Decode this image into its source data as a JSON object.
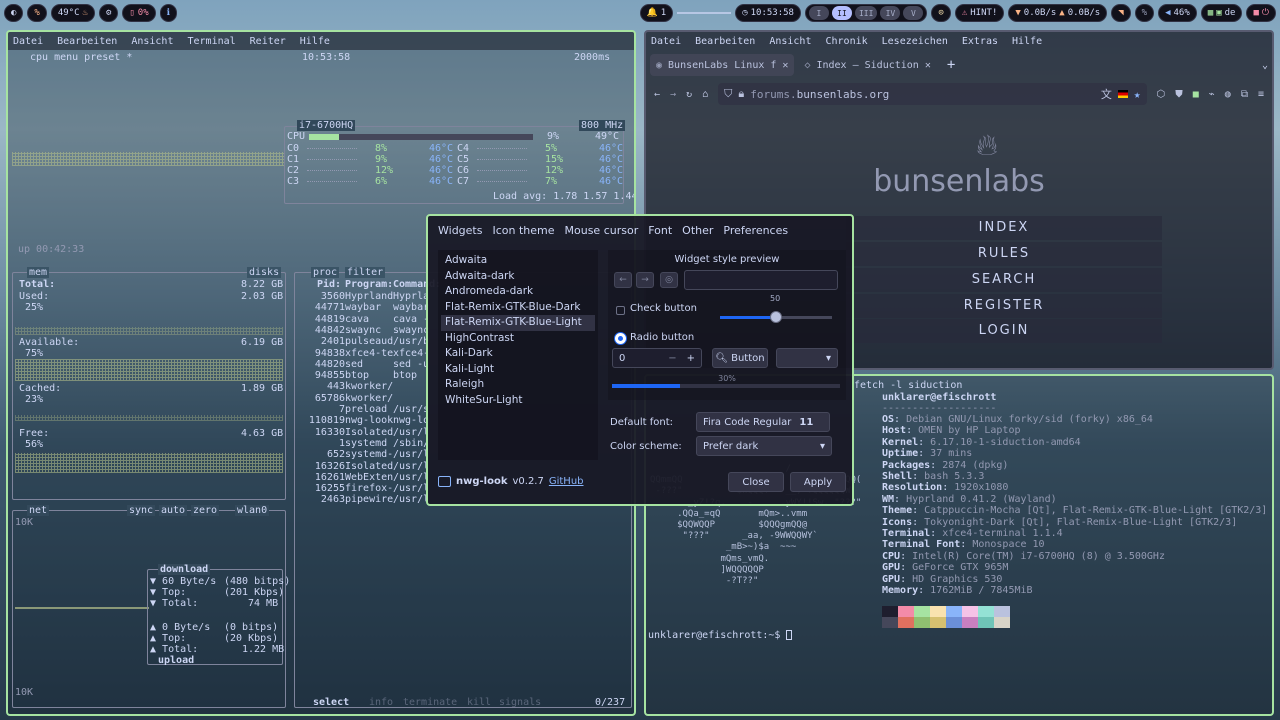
{
  "topbar": {
    "temp": "49°C",
    "battery": "0%",
    "notifications": "1",
    "clock": "10:53:58",
    "workspaces": [
      "I",
      "II",
      "III",
      "IV",
      "V"
    ],
    "active_workspace": "II",
    "hint": "HINT!",
    "net_down": "0.0B/s",
    "net_up": "0.0B/s",
    "volume": "46%",
    "keyboard": "de"
  },
  "btop": {
    "menu": [
      "Datei",
      "Bearbeiten",
      "Ansicht",
      "Terminal",
      "Reiter",
      "Hilfe"
    ],
    "header_left": "cpu   menu  preset *",
    "header_clock": "10:53:58",
    "header_interval": "2000ms",
    "cpu_model": "i7-6700HQ",
    "cpu_freq": "800 MHz",
    "cpu_total_label": "CPU",
    "cpu_total_pct": "9%",
    "cpu_total_temp": "49°C",
    "cpu_total_fraction": 0.09,
    "cores": [
      {
        "name": "C0",
        "pct": "8%",
        "temp": "46°C"
      },
      {
        "name": "C1",
        "pct": "9%",
        "temp": "46°C"
      },
      {
        "name": "C2",
        "pct": "12%",
        "temp": "46°C"
      },
      {
        "name": "C3",
        "pct": "6%",
        "temp": "46°C"
      },
      {
        "name": "C4",
        "pct": "5%",
        "temp": "46°C"
      },
      {
        "name": "C5",
        "pct": "15%",
        "temp": "46°C"
      },
      {
        "name": "C6",
        "pct": "12%",
        "temp": "46°C"
      },
      {
        "name": "C7",
        "pct": "7%",
        "temp": "46°C"
      }
    ],
    "load_avg": "Load avg: 1.78 1.57 1.44",
    "uptime": "up 00:42:33",
    "mem_title": "mem",
    "disks_title": "disks",
    "mem": {
      "total_label": "Total:",
      "total": "8.22 GB",
      "used_label": "Used:",
      "used": "2.03 GB",
      "used_pct": "25%",
      "avail_label": "Available:",
      "avail": "6.19 GB",
      "avail_pct": "75%",
      "cached_label": "Cached:",
      "cached": "1.89 GB",
      "cached_pct": "23%",
      "free_label": "Free:",
      "free": "4.63 GB",
      "free_pct": "56%"
    },
    "proc_title": "proc",
    "proc_filter": "filter",
    "proc_headers": {
      "pid": "Pid:",
      "program": "Program:",
      "command": "Command:"
    },
    "procs": [
      {
        "pid": "3560",
        "prog": "Hyprland",
        "cmd": "Hyprla"
      },
      {
        "pid": "44771",
        "prog": "waybar",
        "cmd": "waybar"
      },
      {
        "pid": "44819",
        "prog": "cava",
        "cmd": "cava -"
      },
      {
        "pid": "44842",
        "prog": "swaync",
        "cmd": "swaync"
      },
      {
        "pid": "2401",
        "prog": "pulseaud",
        "cmd": "/usr/b"
      },
      {
        "pid": "94838",
        "prog": "xfce4-te",
        "cmd": "xfce4-"
      },
      {
        "pid": "44820",
        "prog": "sed",
        "cmd": "sed -u"
      },
      {
        "pid": "94855",
        "prog": "btop",
        "cmd": "btop"
      },
      {
        "pid": "443",
        "prog": "kworker/",
        "cmd": ""
      },
      {
        "pid": "65786",
        "prog": "kworker/",
        "cmd": ""
      },
      {
        "pid": "7",
        "prog": "preload",
        "cmd": "/usr/s"
      },
      {
        "pid": "110819",
        "prog": "nwg-look",
        "cmd": "nwg-lo"
      },
      {
        "pid": "16330",
        "prog": "Isolated",
        "cmd": "/usr/l"
      },
      {
        "pid": "1",
        "prog": "systemd",
        "cmd": "/sbin/"
      },
      {
        "pid": "652",
        "prog": "systemd-",
        "cmd": "/usr/l"
      },
      {
        "pid": "16326",
        "prog": "Isolated",
        "cmd": "/usr/l"
      },
      {
        "pid": "16261",
        "prog": "WebExten",
        "cmd": "/usr/l"
      },
      {
        "pid": "16255",
        "prog": "firefox-",
        "cmd": "/usr/l"
      },
      {
        "pid": "2463",
        "prog": "pipewire",
        "cmd": "/usr/l"
      }
    ],
    "proc_bottom": {
      "select": "select",
      "info": "info",
      "terminate": "terminate",
      "kill": "kill",
      "signals": "signals",
      "count": "0/237"
    },
    "net_title": "net",
    "net_opts": [
      "sync",
      "auto",
      "zero"
    ],
    "net_iface": "wlan0",
    "net_scale_top": "10K",
    "net_scale_bottom": "10K",
    "download_label": "download",
    "dl_rate": "60 Byte/s",
    "dl_rate_bits": "(480 bitps)",
    "dl_top_label": "Top:",
    "dl_top": "(201 Kbps)",
    "dl_total_label": "Total:",
    "dl_total": "74 MB",
    "ul_rate": "0 Byte/s",
    "ul_rate_bits": "(0 bitps)",
    "ul_top_label": "Top:",
    "ul_top": "(20 Kbps)",
    "ul_total_label": "Total:",
    "ul_total": "1.22 MB",
    "upload_label": "upload"
  },
  "firefox": {
    "menu": [
      "Datei",
      "Bearbeiten",
      "Ansicht",
      "Chronik",
      "Lesezeichen",
      "Extras",
      "Hilfe"
    ],
    "tabs": [
      {
        "title": "BunsenLabs Linux f"
      },
      {
        "title": "Index – Siduction"
      }
    ],
    "url_host": "forums.",
    "url_domain": "bunsenlabs.org",
    "logo_text": "bunsenlabs",
    "site_menu": [
      "INDEX",
      "RULES",
      "SEARCH",
      "REGISTER",
      "LOGIN"
    ]
  },
  "fetch": {
    "command": "fetch -l siduction",
    "user_host": "unklarer@efischrott",
    "separator": "-------------------",
    "info": [
      {
        "key": "OS",
        "val": "Debian GNU/Linux forky/sid (forky) x86_64"
      },
      {
        "key": "Host",
        "val": "OMEN by HP Laptop"
      },
      {
        "key": "Kernel",
        "val": "6.17.10-1-siduction-amd64"
      },
      {
        "key": "Uptime",
        "val": "37 mins"
      },
      {
        "key": "Packages",
        "val": "2874 (dpkg)"
      },
      {
        "key": "Shell",
        "val": "bash 5.3.3"
      },
      {
        "key": "Resolution",
        "val": "1920x1080"
      },
      {
        "key": "WM",
        "val": "Hyprland 0.41.2 (Wayland)"
      },
      {
        "key": "Theme",
        "val": "Catppuccin-Mocha [Qt], Flat-Remix-GTK-Blue-Light [GTK2/3]"
      },
      {
        "key": "Icons",
        "val": "Tokyonight-Dark [Qt], Flat-Remix-Blue-Light [GTK2/3]"
      },
      {
        "key": "Terminal",
        "val": "xfce4-terminal 1.1.4"
      },
      {
        "key": "Terminal Font",
        "val": "Monospace 10"
      },
      {
        "key": "CPU",
        "val": "Intel(R) Core(TM) i7-6700HQ (8) @ 3.500GHz"
      },
      {
        "key": "GPU",
        "val": "GeForce GTX 965M"
      },
      {
        "key": "GPU",
        "val": "HD Graphics 530"
      },
      {
        "key": "Memory",
        "val": "1762MiB / 7845MiB"
      }
    ],
    "ascii": [
      "                         /",
      "QQmmQQ        -QQQQgmQP     jQQWmggmQQ(",
      " -???\"         \"$WQQQY`  __, ?QQQQQQW!",
      "       _yZ!?q,    -     .yWY!!Sw, \"???\"",
      "     .QQa_=qQ       mQm>..vmm",
      "     $QQWQQP        $QQQgmQQ@",
      "      \"???\"      _aa, -9WWQQWY`",
      "              _mB>~)$a  ~~~",
      "             mQms_vmQ.",
      "             ]WQQQQQP",
      "              -?T??\""
    ],
    "prompt": "unklarer@efischrott:~$",
    "palette": [
      "#1e1e2e",
      "#f38ba8",
      "#a6e3a1",
      "#f9e2af",
      "#89b4fa",
      "#f5c2e7",
      "#94e2d5",
      "#bac2de",
      "#45475a",
      "#e0705f",
      "#8fbf70",
      "#d6c070",
      "#6b8fd8",
      "#c97fc0",
      "#6fc4b7",
      "#d8d4c8"
    ]
  },
  "nwg": {
    "tabs": [
      "Widgets",
      "Icon theme",
      "Mouse cursor",
      "Font",
      "Other",
      "Preferences"
    ],
    "themes": [
      "Adwaita",
      "Adwaita-dark",
      "Andromeda-dark",
      "Flat-Remix-GTK-Blue-Dark",
      "Flat-Remix-GTK-Blue-Light",
      "HighContrast",
      "Kali-Dark",
      "Kali-Light",
      "Raleigh",
      "WhiteSur-Light"
    ],
    "selected_theme": "Flat-Remix-GTK-Blue-Light",
    "preview_title": "Widget style preview",
    "check_label": "Check button",
    "radio_label": "Radio button",
    "scale_value": "50",
    "scale_fraction": 0.5,
    "spin_value": "0",
    "button_label": "Button",
    "progress_label": "30%",
    "progress_fraction": 0.3,
    "default_font_label": "Default font:",
    "font_name": "Fira Code Regular",
    "font_size": "11",
    "color_scheme_label": "Color scheme:",
    "color_scheme": "Prefer dark",
    "app_name": "nwg-look",
    "version": "v0.2.7",
    "github": "GitHub",
    "close": "Close",
    "apply": "Apply",
    "accent": "#1e66f5"
  }
}
